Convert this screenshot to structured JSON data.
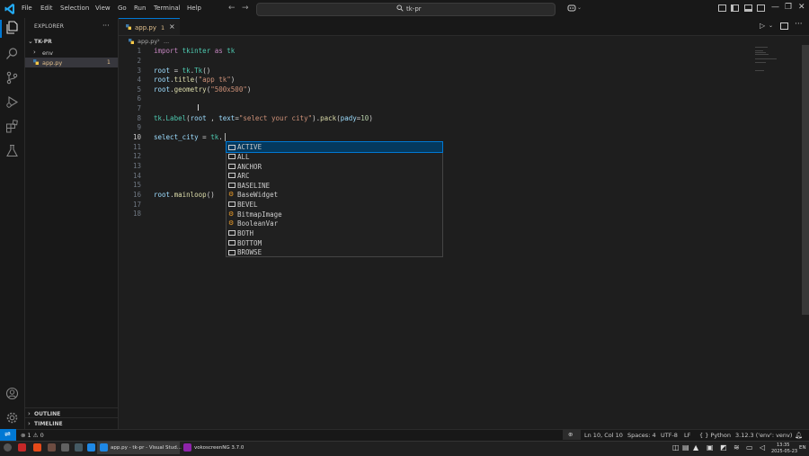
{
  "menu": [
    "File",
    "Edit",
    "Selection",
    "View",
    "Go",
    "Run",
    "Terminal",
    "Help"
  ],
  "search": {
    "text": "tk-pr"
  },
  "explorer": {
    "title": "EXPLORER",
    "more": "···",
    "folder": "TK-PR",
    "items": [
      {
        "name": "env",
        "type": "folder"
      },
      {
        "name": "app.py",
        "type": "file",
        "badge": "1"
      }
    ],
    "outline": "OUTLINE",
    "timeline": "TIMELINE"
  },
  "tab": {
    "label": "app.py",
    "count": "1",
    "close": "×"
  },
  "breadcrumb": {
    "file": "app.py",
    "sep": "›",
    "more": "..."
  },
  "editor": {
    "lines": [
      "1",
      "2",
      "3",
      "4",
      "5",
      "6",
      "7",
      "8",
      "9",
      "10",
      "11",
      "12",
      "13",
      "14",
      "15",
      "16",
      "17",
      "18"
    ],
    "active_line": "10"
  },
  "suggest": {
    "items": [
      {
        "label": "ACTIVE",
        "kind": "constant"
      },
      {
        "label": "ALL",
        "kind": "constant"
      },
      {
        "label": "ANCHOR",
        "kind": "constant"
      },
      {
        "label": "ARC",
        "kind": "constant"
      },
      {
        "label": "BASELINE",
        "kind": "constant"
      },
      {
        "label": "BaseWidget",
        "kind": "class"
      },
      {
        "label": "BEVEL",
        "kind": "constant"
      },
      {
        "label": "BitmapImage",
        "kind": "class"
      },
      {
        "label": "BooleanVar",
        "kind": "class"
      },
      {
        "label": "BOTH",
        "kind": "constant"
      },
      {
        "label": "BOTTOM",
        "kind": "constant"
      },
      {
        "label": "BROWSE",
        "kind": "constant"
      }
    ]
  },
  "status": {
    "problems": "⊗ 1 ⚠ 0",
    "position": "Ln 10, Col 10",
    "spaces": "Spaces: 4",
    "encoding": "UTF-8",
    "eol": "LF",
    "language": "{ } Python",
    "interpreter": "3.12.3 ('env': venv)"
  },
  "taskbar": {
    "vscode_title": "app.py - tk-pr - Visual Stud...",
    "recorder_title": "vokoscreenNG 3.7.0",
    "time": "13:35",
    "date": "2025-05-23",
    "lang": "EN"
  },
  "colors": {
    "accent": "#0078d4",
    "modified": "#e2c08d",
    "keyword": "#c586c0",
    "string": "#ce9178"
  }
}
